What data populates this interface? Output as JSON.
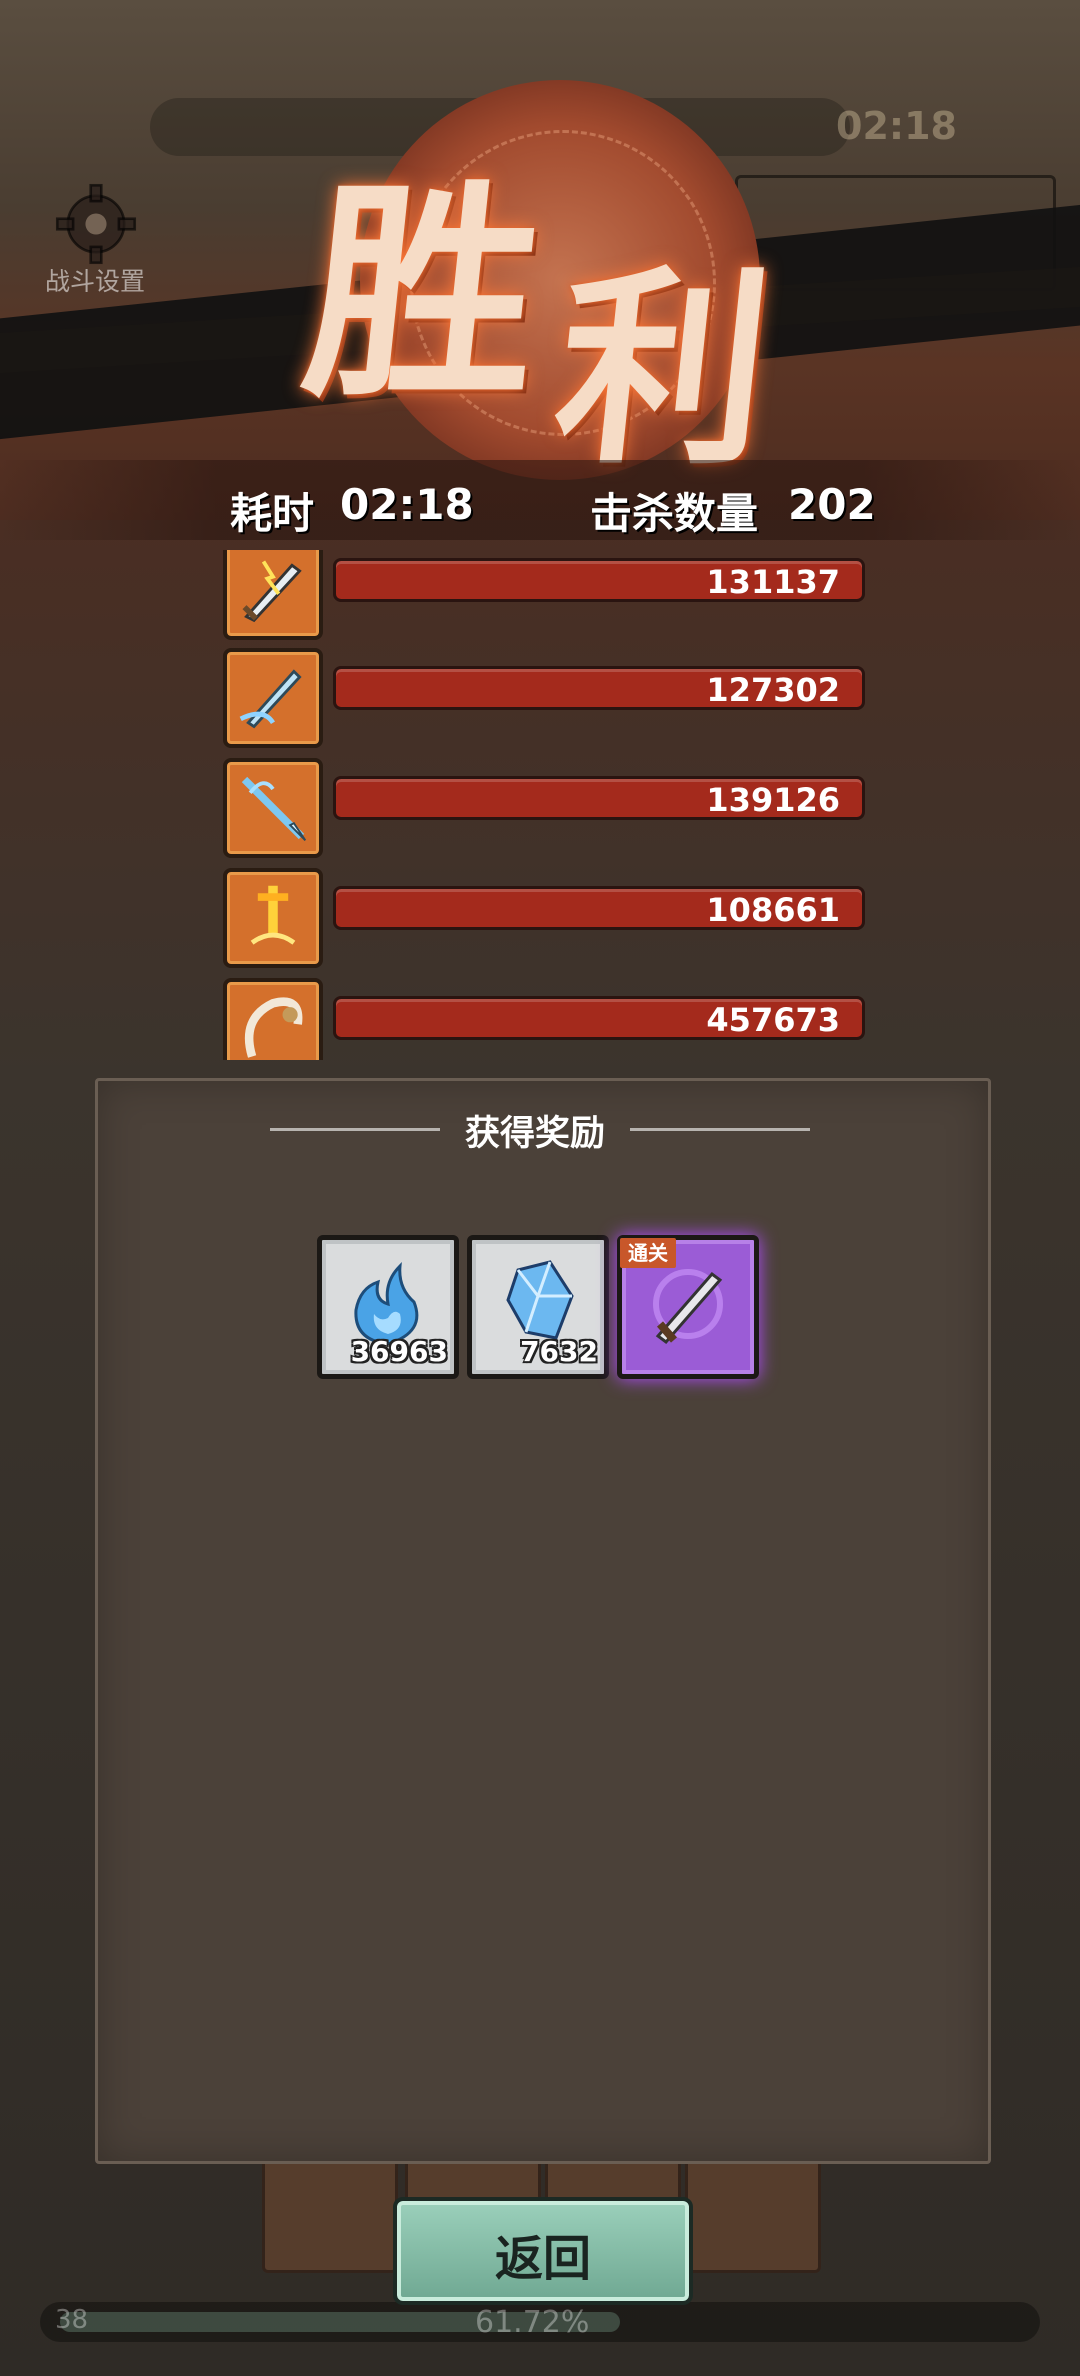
{
  "hud": {
    "timer": "02:18",
    "settings_label": "战斗设置"
  },
  "title": {
    "char1": "胜",
    "char2": "利"
  },
  "stats": {
    "time_label": "耗时",
    "time_value": "02:18",
    "kills_label": "击杀数量",
    "kills_value": "202"
  },
  "weapons": [
    {
      "icon": "lightning-sword-icon",
      "damage": "131137"
    },
    {
      "icon": "frost-sword-icon",
      "damage": "127302"
    },
    {
      "icon": "ice-spear-icon",
      "damage": "139126"
    },
    {
      "icon": "golden-sword-icon",
      "damage": "108661"
    },
    {
      "icon": "crescent-blade-icon",
      "damage": "457673"
    }
  ],
  "rewards": {
    "title": "获得奖励",
    "items": [
      {
        "icon": "blue-flame-icon",
        "count": "36963",
        "tag": ""
      },
      {
        "icon": "blue-crystal-icon",
        "count": "7632",
        "tag": ""
      },
      {
        "icon": "purple-sword-icon",
        "count": "",
        "tag": "通关"
      }
    ]
  },
  "buttons": {
    "return_label": "返回"
  },
  "bottom": {
    "level": "38",
    "progress_text": "61.72%"
  },
  "colors": {
    "damage_bar": "#a42a1c",
    "weapon_frame": "#d4702c",
    "return_button": "#8ec3ae",
    "purple_rarity": "#9b5cd6"
  }
}
